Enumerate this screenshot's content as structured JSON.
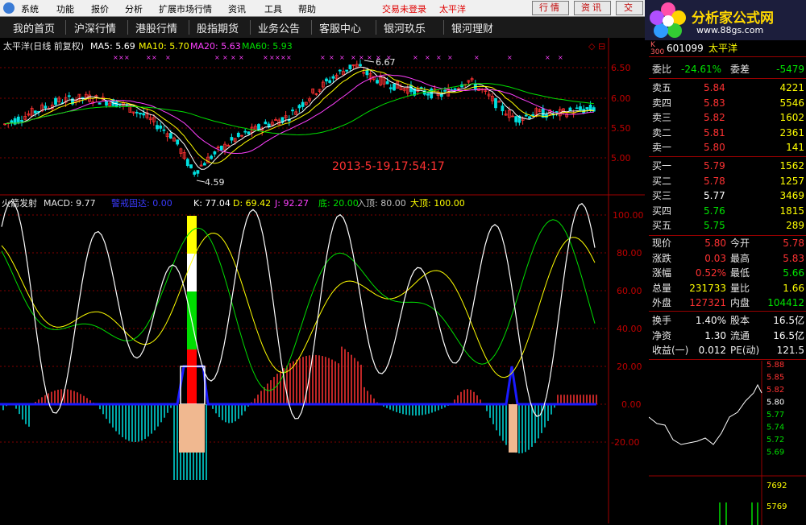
{
  "menu": {
    "items": [
      "系统",
      "功能",
      "报价",
      "分析",
      "扩展市场行情",
      "资讯",
      "工具",
      "帮助"
    ],
    "status": "交易未登录",
    "stock_short": "太平洋",
    "buttons": [
      "行情",
      "资讯",
      "交"
    ]
  },
  "nav": [
    "我的首页",
    "沪深行情",
    "港股行情",
    "股指期货",
    "业务公告",
    "客服中心",
    "银河玖乐",
    "银河理财"
  ],
  "brand": {
    "title": "分析家公式网",
    "url": "www.88gs.com"
  },
  "main_chart": {
    "label": "太平洋(日线 前复权)",
    "ma": [
      {
        "name": "MA5: 5.69",
        "color": "#ffffff"
      },
      {
        "name": "MA10: 5.70",
        "color": "#ffff00"
      },
      {
        "name": "MA20: 5.63",
        "color": "#ff40ff"
      },
      {
        "name": "MA60: 5.93",
        "color": "#00e000"
      }
    ],
    "y_ticks": [
      "6.50",
      "6.00",
      "5.50",
      "5.00"
    ],
    "high_label": "6.67",
    "low_label": "4.59",
    "timestamp": "2013-5-19,17:54:17"
  },
  "indicator": {
    "label": "火箭发射",
    "macd": "MACD: 9.77",
    "warn": "警戒固达: 0.00",
    "k": "K: 77.04",
    "d": "D: 69.42",
    "j": "J: 92.27",
    "di": "底: 20.00",
    "ru": "入顶: 80.00",
    "da": "大顶: 100.00",
    "y_ticks": [
      "100.00",
      "80.00",
      "60.00",
      "40.00",
      "20.00",
      "0.00",
      "-20.00"
    ]
  },
  "quote": {
    "code": "601099",
    "name": "太平洋",
    "weibi_label": "委比",
    "weibi": "-24.61%",
    "weicha_label": "委差",
    "weicha": "-5479",
    "asks": [
      {
        "label": "卖五",
        "price": "5.84",
        "vol": "4221"
      },
      {
        "label": "卖四",
        "price": "5.83",
        "vol": "5546"
      },
      {
        "label": "卖三",
        "price": "5.82",
        "vol": "1602"
      },
      {
        "label": "卖二",
        "price": "5.81",
        "vol": "2361"
      },
      {
        "label": "卖一",
        "price": "5.80",
        "vol": "141"
      }
    ],
    "bids": [
      {
        "label": "买一",
        "price": "5.79",
        "vol": "1562"
      },
      {
        "label": "买二",
        "price": "5.78",
        "vol": "1257"
      },
      {
        "label": "买三",
        "price": "5.77",
        "vol": "3469"
      },
      {
        "label": "买四",
        "price": "5.76",
        "vol": "1815"
      },
      {
        "label": "买五",
        "price": "5.75",
        "vol": "289"
      }
    ],
    "stats": [
      {
        "l1": "现价",
        "v1": "5.80",
        "c1": "r",
        "l2": "今开",
        "v2": "5.78",
        "c2": "r"
      },
      {
        "l1": "涨跌",
        "v1": "0.03",
        "c1": "r",
        "l2": "最高",
        "v2": "5.83",
        "c2": "r"
      },
      {
        "l1": "涨幅",
        "v1": "0.52%",
        "c1": "r",
        "l2": "最低",
        "v2": "5.66",
        "c2": "g"
      },
      {
        "l1": "总量",
        "v1": "231733",
        "c1": "y",
        "l2": "量比",
        "v2": "1.66",
        "c2": "y"
      },
      {
        "l1": "外盘",
        "v1": "127321",
        "c1": "r",
        "l2": "内盘",
        "v2": "104412",
        "c2": "g"
      }
    ],
    "stats2": [
      {
        "l1": "换手",
        "v1": "1.40%",
        "l2": "股本",
        "v2": "16.5亿"
      },
      {
        "l1": "净资",
        "v1": "1.30",
        "l2": "流通",
        "v2": "16.5亿"
      },
      {
        "l1": "收益(一)",
        "v1": "0.012",
        "l2": "PE(动)",
        "v2": "121.5"
      }
    ],
    "mini_price_ticks": [
      "5.88",
      "5.85",
      "5.82",
      "5.80",
      "5.77",
      "5.74",
      "5.72",
      "5.69"
    ],
    "mini_vol_ticks": [
      "7692",
      "5769"
    ]
  },
  "colors": {
    "up": "#ff3232",
    "down": "#00e0e0",
    "grid": "#800000",
    "ma5": "#ffffff",
    "ma10": "#ffff00",
    "ma20": "#ff40ff",
    "ma60": "#00e000"
  }
}
